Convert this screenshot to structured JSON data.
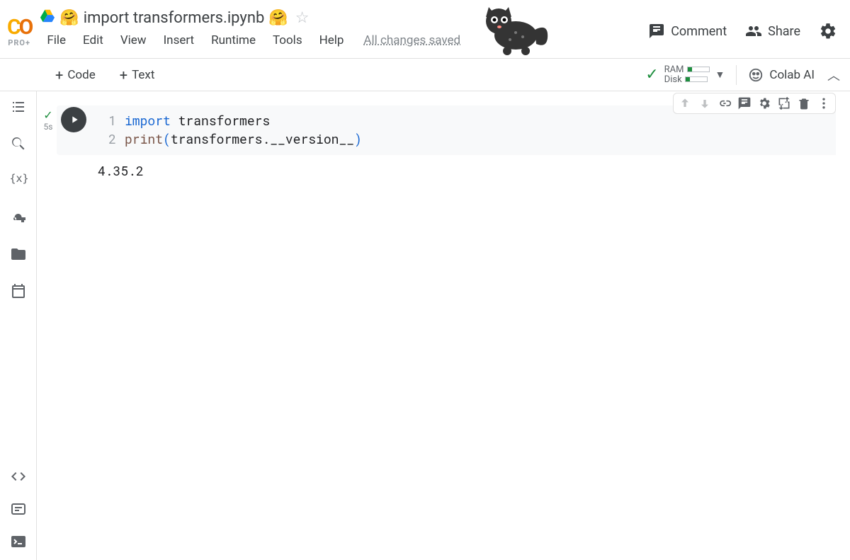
{
  "header": {
    "pro_label": "PRO+",
    "title_prefix_emoji": "🤗",
    "title": "import transformers.ipynb",
    "title_suffix_emoji": "🤗",
    "menu": {
      "file": "File",
      "edit": "Edit",
      "view": "View",
      "insert": "Insert",
      "runtime": "Runtime",
      "tools": "Tools",
      "help": "Help",
      "status": "All changes saved"
    },
    "actions": {
      "comment": "Comment",
      "share": "Share"
    }
  },
  "toolbar": {
    "code": "Code",
    "text": "Text",
    "ram_label": "RAM",
    "disk_label": "Disk",
    "ai_label": "Colab AI"
  },
  "cell": {
    "exec_time": "5s",
    "line1_num": "1",
    "line2_num": "2",
    "code": {
      "kw_import": "import",
      "mod": " transformers",
      "fn_print": "print",
      "open": "(",
      "arg": "transformers.__version__",
      "close": ")"
    },
    "output": "4.35.2"
  }
}
